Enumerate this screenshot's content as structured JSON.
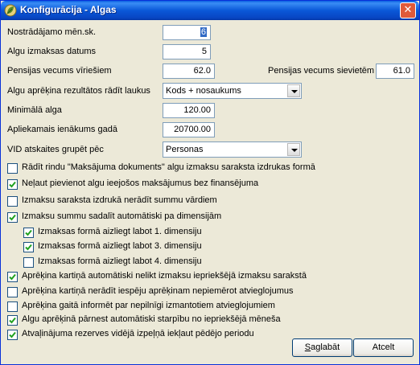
{
  "window": {
    "title": "Konfigurācija - Algas",
    "close_label": "✕"
  },
  "fields": {
    "months_label": "Nostrādājamo mēn.sk.",
    "months_value": "6",
    "paydate_label": "Algu izmaksas datums",
    "paydate_value": "5",
    "pension_men_label": "Pensijas vecums vīriešiem",
    "pension_men_value": "62.0",
    "pension_women_label": "Pensijas vecums sievietēm",
    "pension_women_value": "61.0",
    "show_fields_label": "Algu aprēķina rezultātos rādīt laukus",
    "show_fields_value": "Kods + nosaukums",
    "min_wage_label": "Minimālā alga",
    "min_wage_value": "120.00",
    "taxable_income_label": "Apliekamais ienākums gadā",
    "taxable_income_value": "20700.00",
    "vid_group_label": "VID atskaites grupēt pēc",
    "vid_group_value": "Personas"
  },
  "checkboxes": [
    {
      "label": "Rādīt rindu \"Maksājuma dokuments\" algu izmaksu saraksta izdrukas formā",
      "checked": false
    },
    {
      "label": "Neļaut pievienot algu ieejošos maksājumus bez finansējuma",
      "checked": true
    },
    {
      "label": "Izmaksu saraksta izdrukā nerādīt summu vārdiem",
      "checked": false
    },
    {
      "label": "Izmaksu summu sadalīt automātiski pa dimensijām",
      "checked": true
    },
    {
      "label": "Izmaksas formā aizliegt labot 1. dimensiju",
      "checked": true
    },
    {
      "label": "Izmaksas formā aizliegt labot 3. dimensiju",
      "checked": true
    },
    {
      "label": "Izmaksas formā aizliegt labot 4. dimensiju",
      "checked": false
    },
    {
      "label": "Aprēķina kartiņā automātiski nelikt izmaksu iepriekšējā izmaksu sarakstā",
      "checked": true
    },
    {
      "label": "Aprēķina kartiņā nerādīt iespēju aprēķinam nepiemērot atvieglojumus",
      "checked": false
    },
    {
      "label": "Aprēķina gaitā informēt par nepilnīgi izmantotiem atvieglojumiem",
      "checked": false
    },
    {
      "label": "Algu aprēķinā pārnest automātiski starpību no iepriekšējā mēneša",
      "checked": true
    },
    {
      "label": "Atvaļinājuma rezerves vidējā izpeļņā iekļaut pēdējo periodu",
      "checked": true
    }
  ],
  "buttons": {
    "save_prefix": "S",
    "save_rest": "aglabāt",
    "cancel": "Atcelt"
  }
}
